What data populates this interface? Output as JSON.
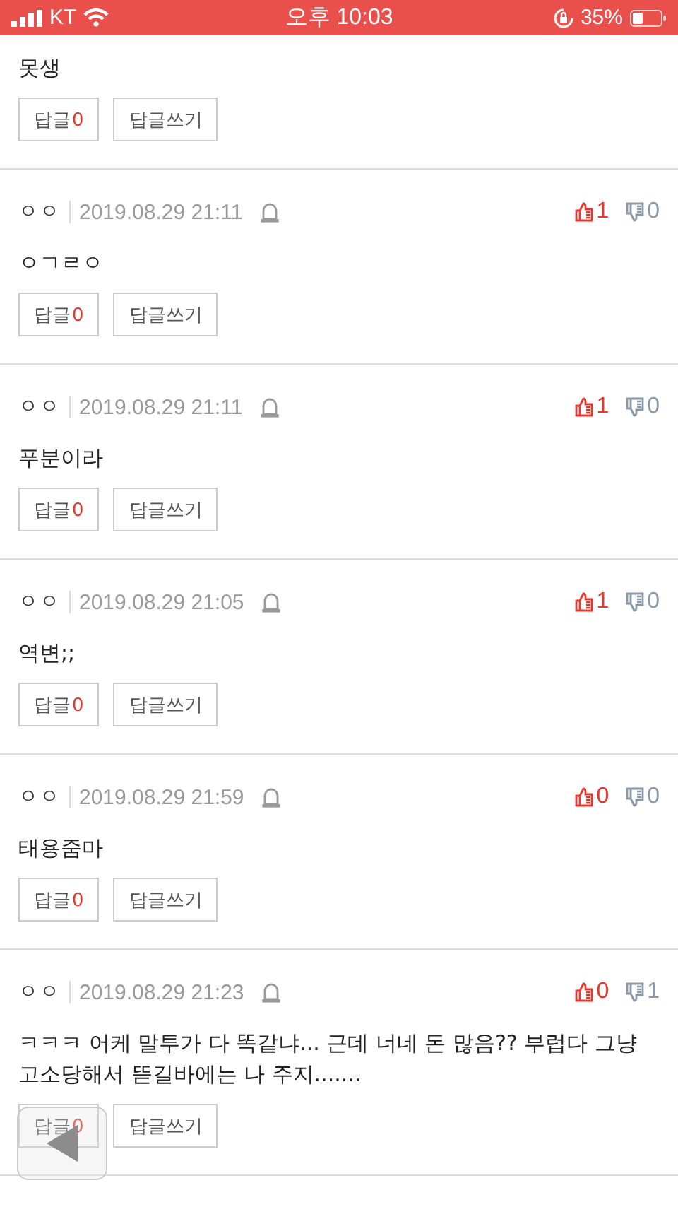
{
  "status_bar": {
    "carrier": "KT",
    "time": "오후 10:03",
    "battery": "35%"
  },
  "partial_comment": {
    "text": "못생",
    "reply_label": "답글",
    "reply_count": "0",
    "write_label": "답글쓰기"
  },
  "comments": [
    {
      "author": "ㅇㅇ",
      "date": "2019.08.29 21:11",
      "text": "ㅇㄱㄹㅇ",
      "likes": "1",
      "dislikes": "0",
      "reply_label": "답글",
      "reply_count": "0",
      "write_label": "답글쓰기"
    },
    {
      "author": "ㅇㅇ",
      "date": "2019.08.29 21:11",
      "text": "푸분이라",
      "likes": "1",
      "dislikes": "0",
      "reply_label": "답글",
      "reply_count": "0",
      "write_label": "답글쓰기"
    },
    {
      "author": "ㅇㅇ",
      "date": "2019.08.29 21:05",
      "text": "역변;;",
      "likes": "1",
      "dislikes": "0",
      "reply_label": "답글",
      "reply_count": "0",
      "write_label": "답글쓰기"
    },
    {
      "author": "ㅇㅇ",
      "date": "2019.08.29 21:59",
      "text": "태용줌마",
      "likes": "0",
      "dislikes": "0",
      "reply_label": "답글",
      "reply_count": "0",
      "write_label": "답글쓰기"
    },
    {
      "author": "ㅇㅇ",
      "date": "2019.08.29 21:23",
      "text": "ㅋㅋㅋ 어케 말투가 다 똑같냐... 근데 너네 돈 많음?? 부럽다 그냥 고소당해서 뜯길바에는 나 주지.......",
      "likes": "0",
      "dislikes": "1",
      "reply_label": "답글",
      "reply_count": "0",
      "write_label": "답글쓰기"
    }
  ]
}
